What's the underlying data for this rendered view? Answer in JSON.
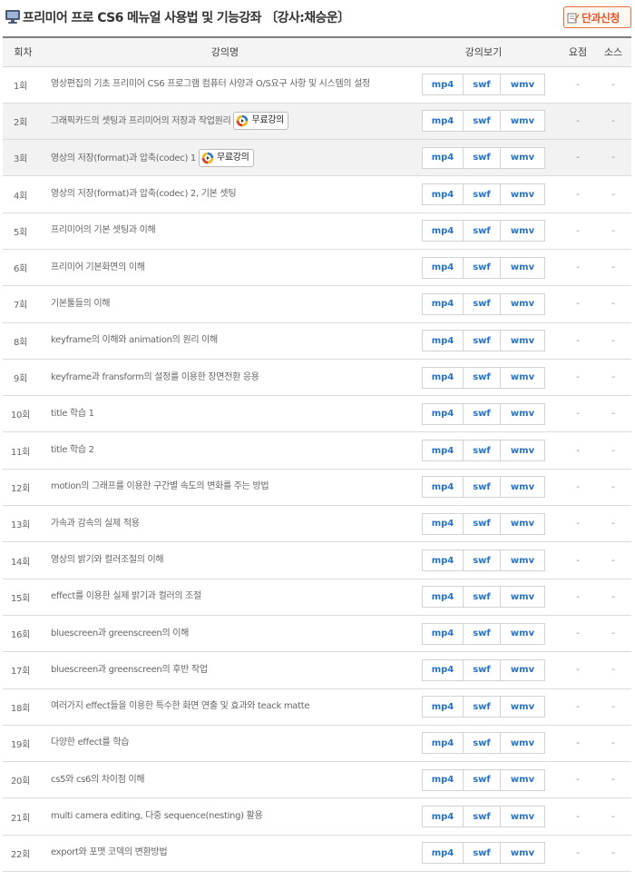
{
  "header": {
    "title": "프리미어 프로 CS6 메뉴얼 사용법 및 기능강좌 〔강사:채승운〕",
    "enroll_label": "단과신청",
    "accent_color": "#e2582a"
  },
  "columns": {
    "no": "회차",
    "title": "강의명",
    "view": "강의보기",
    "summary": "요점",
    "source": "소스"
  },
  "buttons": {
    "mp4": "mp4",
    "swf": "swf",
    "wmv": "wmv"
  },
  "free_label": "무료강의",
  "lectures": [
    {
      "no": "1회",
      "title": "영상편집의 기초 프리미어 CS6 프로그램 컴퓨터 사양과 O/S요구 사항 및 시스템의 설정",
      "summary": "-",
      "source": "-",
      "free": false
    },
    {
      "no": "2회",
      "title": "그래픽카드의 셋팅과 프리미어의 저장과 작업원리",
      "summary": "-",
      "source": "-",
      "free": true
    },
    {
      "no": "3회",
      "title": "영상의 저장(format)과 압축(codec) 1",
      "summary": "-",
      "source": "-",
      "free": true
    },
    {
      "no": "4회",
      "title": "영상의 저장(format)과 압축(codec) 2, 기본 셋팅",
      "summary": "-",
      "source": "-",
      "free": false
    },
    {
      "no": "5회",
      "title": "프리미어의 기본 셋팅과 이해",
      "summary": "-",
      "source": "-",
      "free": false
    },
    {
      "no": "6회",
      "title": "프리미어 기본화면의 이해",
      "summary": "-",
      "source": "-",
      "free": false
    },
    {
      "no": "7회",
      "title": "기본툴들의 이해",
      "summary": "-",
      "source": "-",
      "free": false
    },
    {
      "no": "8회",
      "title": "keyframe의 이해와 animation의 원리 이해",
      "summary": "-",
      "source": "-",
      "free": false
    },
    {
      "no": "9회",
      "title": "keyframe과 fransform의 설정를 이용한 장면전환 응용",
      "summary": "-",
      "source": "-",
      "free": false
    },
    {
      "no": "10회",
      "title": "title 학습 1",
      "summary": "-",
      "source": "-",
      "free": false
    },
    {
      "no": "11회",
      "title": "title 학습 2",
      "summary": "-",
      "source": "-",
      "free": false
    },
    {
      "no": "12회",
      "title": "motion의 그래프를 이용한 구간별 속도의 변화를 주는 방법",
      "summary": "-",
      "source": "-",
      "free": false
    },
    {
      "no": "13회",
      "title": "가속과 감속의 실제 적용",
      "summary": "-",
      "source": "-",
      "free": false
    },
    {
      "no": "14회",
      "title": "영상의 밝기와 컬러조절의 이해",
      "summary": "-",
      "source": "-",
      "free": false
    },
    {
      "no": "15회",
      "title": "effect를 이용한 실제 밝기과 컬러의 조절",
      "summary": "-",
      "source": "-",
      "free": false
    },
    {
      "no": "16회",
      "title": "bluescreen과 greenscreen의 이해",
      "summary": "-",
      "source": "-",
      "free": false
    },
    {
      "no": "17회",
      "title": "bluescreen과 greenscreen의 후반 작업",
      "summary": "-",
      "source": "-",
      "free": false
    },
    {
      "no": "18회",
      "title": "여러가지 effect들을 이용한 특수한 화면 연출 및 효과와 teack matte",
      "summary": "-",
      "source": "-",
      "free": false
    },
    {
      "no": "19회",
      "title": "다양한 effect를 학습",
      "summary": "-",
      "source": "-",
      "free": false
    },
    {
      "no": "20회",
      "title": "cs5와 cs6의 차이점 이해",
      "summary": "-",
      "source": "-",
      "free": false
    },
    {
      "no": "21회",
      "title": "multi camera editing, 다중 sequence(nesting) 활용",
      "summary": "-",
      "source": "-",
      "free": false
    },
    {
      "no": "22회",
      "title": "export와 포맷 코덱의 변환방법",
      "summary": "-",
      "source": "-",
      "free": false
    }
  ]
}
